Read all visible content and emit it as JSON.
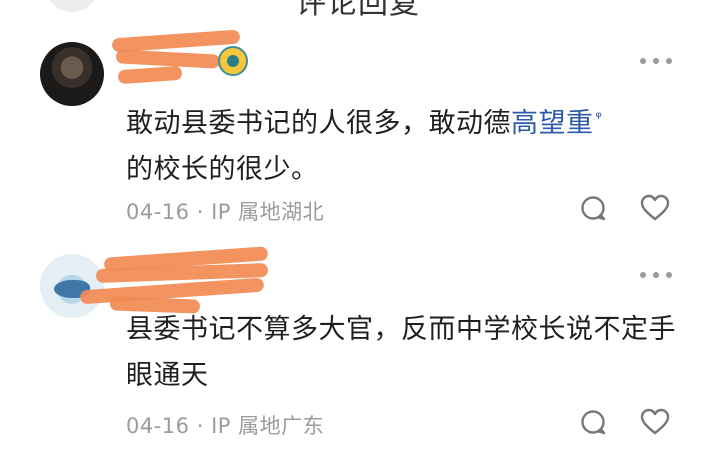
{
  "header": {
    "title": "评论回复",
    "partial_avatar_visible": true
  },
  "comments": [
    {
      "username": "已隐藏用户名",
      "text_before_link": "敢动县委书记的人很多，敢动",
      "first_char": "德",
      "link_text": "高望重",
      "search_marker": "ᵠ",
      "text_after_link": "的校长的很少。",
      "date": "04-16",
      "separator": "·",
      "location": "IP 属地湖北"
    },
    {
      "username": "已隐藏用户名",
      "text": "县委书记不算多大官，反而中学校长说不定手眼通天",
      "date": "04-16",
      "separator": "·",
      "location": "IP 属地广东"
    }
  ],
  "icons": {
    "more": "more-horizontal-icon",
    "reply": "comment-bubble-icon",
    "like": "heart-icon",
    "badge": "user-badge-icon"
  },
  "colors": {
    "text": "#1f1f1f",
    "meta": "#9b9b9b",
    "link": "#2d5aa8",
    "scribble": "#f28a52"
  }
}
